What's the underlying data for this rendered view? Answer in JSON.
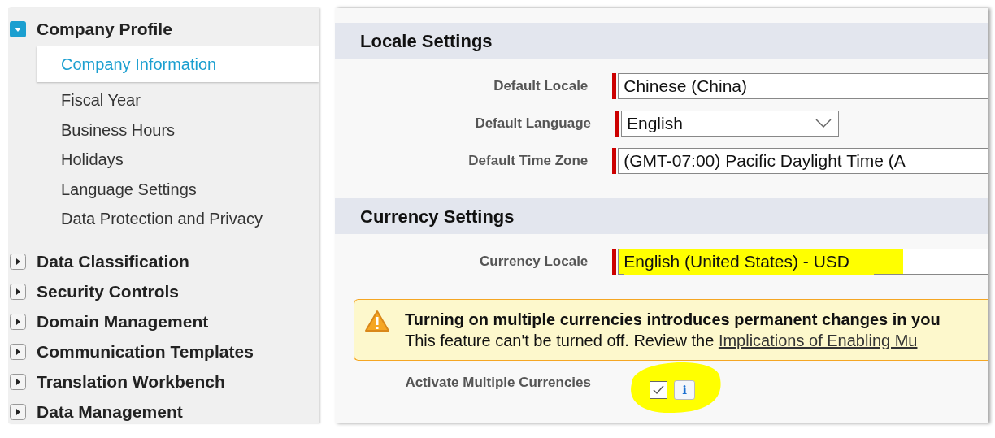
{
  "sidebar": {
    "groups": [
      {
        "label": "Company Profile",
        "expanded": true,
        "children": [
          {
            "label": "Company Information",
            "selected": true
          },
          {
            "label": "Fiscal Year",
            "selected": false
          },
          {
            "label": "Business Hours",
            "selected": false
          },
          {
            "label": "Holidays",
            "selected": false
          },
          {
            "label": "Language Settings",
            "selected": false
          },
          {
            "label": "Data Protection and Privacy",
            "selected": false
          }
        ]
      },
      {
        "label": "Data Classification",
        "expanded": false
      },
      {
        "label": "Security Controls",
        "expanded": false
      },
      {
        "label": "Domain Management",
        "expanded": false
      },
      {
        "label": "Communication Templates",
        "expanded": false
      },
      {
        "label": "Translation Workbench",
        "expanded": false
      },
      {
        "label": "Data Management",
        "expanded": false
      }
    ]
  },
  "sections": [
    {
      "title": "Locale Settings",
      "fields": [
        {
          "label": "Default Locale",
          "kind": "text",
          "value": "Chinese (China)",
          "required": true
        },
        {
          "label": "Default Language",
          "kind": "select",
          "value": "English",
          "required": true
        },
        {
          "label": "Default Time Zone",
          "kind": "text",
          "value": "(GMT-07:00) Pacific Daylight Time (A",
          "required": true
        }
      ]
    },
    {
      "title": "Currency Settings",
      "fields": [
        {
          "label": "Currency Locale",
          "kind": "text",
          "value": "English (United States) - USD",
          "required": true,
          "highlighted": true
        }
      ],
      "warning": {
        "title": "Turning on multiple currencies introduces permanent changes in you",
        "text": "This feature can't be turned off. Review the ",
        "link": "Implications of Enabling Mu"
      },
      "checkbox": {
        "label": "Activate Multiple Currencies",
        "checked": true,
        "info": "i",
        "circled": true
      }
    }
  ]
}
